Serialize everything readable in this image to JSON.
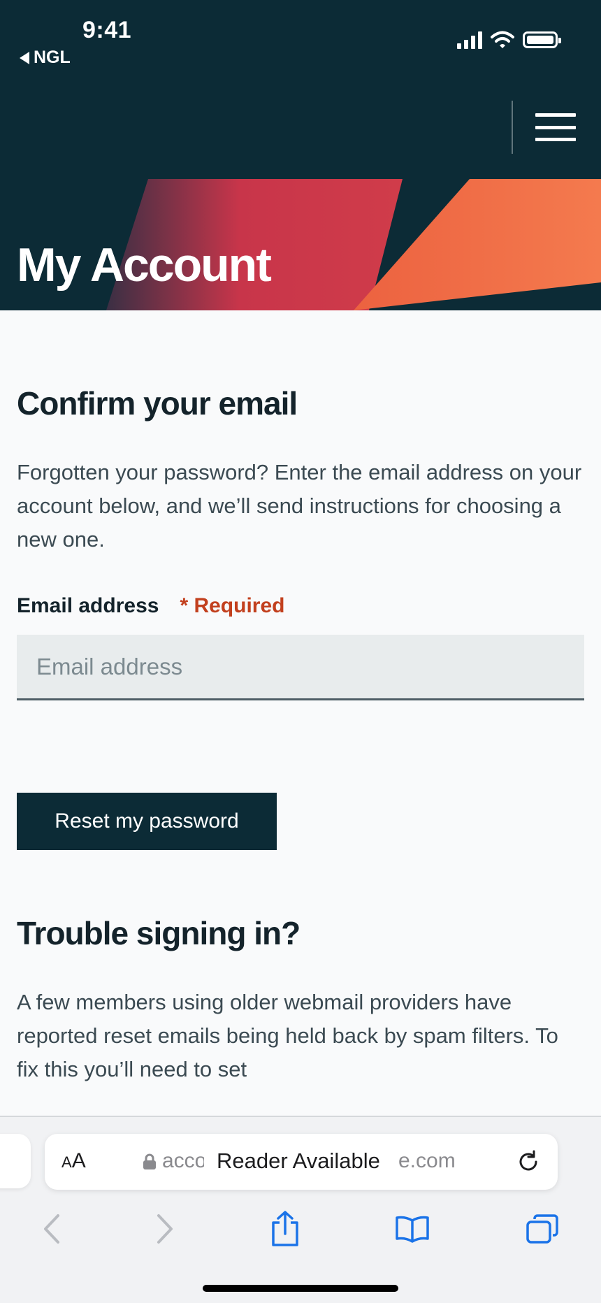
{
  "status_bar": {
    "time": "9:41",
    "back_app": "NGL"
  },
  "header": {
    "title": "My Account",
    "colors": {
      "background": "#0c2b36",
      "red_accent": "#c8354a",
      "orange_accent": "#f07048"
    }
  },
  "confirm": {
    "heading": "Confirm your email",
    "intro": "Forgotten your password? Enter the email address on your account below, and we’ll send instructions for choosing a new one.",
    "email_label": "Email address",
    "required_text": "* Required",
    "email_placeholder": "Email address",
    "email_value": "",
    "submit_label": "Reset my password"
  },
  "trouble": {
    "heading": "Trouble signing in?",
    "body": "A few members using older webmail providers have reported reset emails being held back by spam filters. To fix this you’ll need to set"
  },
  "browser": {
    "aa_small": "A",
    "aa_large": "A",
    "url_prefix": "acco",
    "reader_text": "Reader Available",
    "url_suffix": "e.com",
    "icons": [
      "back-icon",
      "forward-icon",
      "share-icon",
      "bookmarks-icon",
      "tabs-icon",
      "reload-icon",
      "lock-icon"
    ]
  }
}
